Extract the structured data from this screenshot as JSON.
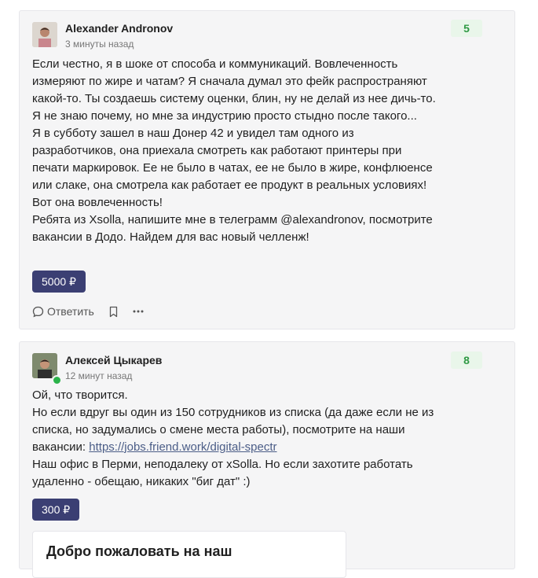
{
  "comments": [
    {
      "author": "Alexander Andronov",
      "time": "3 минуты назад",
      "rating": "5",
      "paragraphs": [
        "Если честно, я в шоке от способа и коммуникаций. Вовлеченность измеряют по жире и чатам? Я сначала думал это фейк распространяют какой-то. Ты создаешь систему оценки, блин, ну не делай из нее дичь-то. Я не знаю почему, но мне за индустрию просто стыдно после такого...",
        "Я в субботу зашел в наш Донер 42 и увидел там одного из разработчиков, она приехала смотреть как работают принтеры при печати маркировок. Ее не было в чатах, ее не было в жире, конфлюенсе или слаке, она смотрела как работает ее продукт в реальных условиях! Вот она вовлеченность!",
        "Ребята из Xsolla, напишите мне в телеграмм @alexandronov, посмотрите вакансии в Додо. Найдем для вас новый челленж!"
      ],
      "donation": "5000 ₽",
      "reply_label": "Ответить"
    },
    {
      "author": "Алексей Цыкарев",
      "time": "12 минут назад",
      "rating": "8",
      "line1": "Ой, что творится.",
      "line2_prefix": "Но если вдруг вы один из 150 сотрудников из списка (да даже если не из списка, но задумались о смене места работы), посмотрите на наши вакансии: ",
      "link": "https://jobs.friend.work/digital-spectr",
      "line3": "Наш офис в Перми, неподалеку от xSolla. Но если захотите работать удаленно - обещаю, никаких \"биг дат\" :)",
      "donation": "300 ₽",
      "promo_title": "Добро пожаловать на наш"
    }
  ],
  "icons": [
    "reply-icon",
    "bookmark-icon",
    "more-icon"
  ],
  "colors": {
    "card_bg": "#f5f5f6",
    "donate_bg": "#3b3f73",
    "rating_bg": "#e9f6ea",
    "rating_text": "#2f9a44",
    "link": "#4b5d87",
    "online": "#2bb34a"
  }
}
